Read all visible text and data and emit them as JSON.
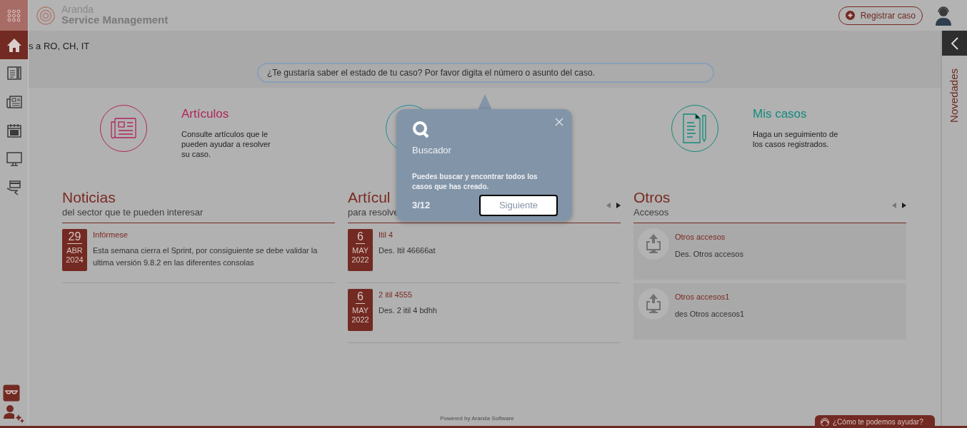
{
  "brand": {
    "line1": "Aranda",
    "line2": "Service Management"
  },
  "header": {
    "register_button": "Registrar caso"
  },
  "sidebar": {
    "items": [
      {
        "kind": "home",
        "selected": true
      },
      {
        "kind": "document",
        "selected": false
      },
      {
        "kind": "newspaper",
        "selected": false
      },
      {
        "kind": "calendar",
        "selected": false
      },
      {
        "kind": "monitor",
        "selected": false
      },
      {
        "kind": "hand",
        "selected": false
      }
    ]
  },
  "breadcrumb": "s a RO, CH, IT",
  "search": {
    "placeholder": "¿Te gustaría saber el estado de tu caso? Por favor digita el número o asunto del caso."
  },
  "features": [
    {
      "kind": "articles",
      "color": "#b0245c",
      "title": "Artículos",
      "text": "Consulte artículos que le pueden ayudar a resolver su caso."
    },
    {
      "kind": "services",
      "color": "#1a8f9c"
    },
    {
      "kind": "cases",
      "color": "#128a7c",
      "title": "Mis casos",
      "text": "Haga un seguimiento de los casos registrados."
    }
  ],
  "sections": [
    {
      "kind": "dated",
      "title": "Noticias",
      "subtitle": "del sector que te pueden interesar",
      "pager": false,
      "items": [
        {
          "day": "29",
          "month": "ABR",
          "year": "2024",
          "title": "Infórmese",
          "text": "Esta semana cierra el Sprint, por consiguiente se debe validar la ultima versión 9.8.2 en las diferentes consolas"
        }
      ]
    },
    {
      "kind": "dated",
      "title": "Artícul",
      "subtitle": "para resolve",
      "pager": true,
      "items": [
        {
          "day": "6",
          "month": "MAY",
          "year": "2022",
          "title": "Itil 4",
          "text": "Des. Itil 46666at"
        },
        {
          "day": "6",
          "month": "MAY",
          "year": "2022",
          "title": "2 itil 4555",
          "text": "Des. 2 itil 4 bdhh"
        }
      ]
    },
    {
      "kind": "access",
      "title": "Otros",
      "subtitle": "Accesos",
      "pager": true,
      "items": [
        {
          "title": "Otros accesos",
          "text": "Des. Otros accesos"
        },
        {
          "title": "Otros accesos1",
          "text": "des Otros accesos1"
        }
      ]
    }
  ],
  "tour": {
    "title": "Buscador",
    "text": "Puedes buscar y encontrar todos los casos que has creado.",
    "step": "3/12",
    "next_button": "Siguiente"
  },
  "side_panel": {
    "label": "Novedades"
  },
  "footer": {
    "text": "Powered by Aranda Software"
  },
  "help_button": "¿Cómo te podemos ayudar?"
}
